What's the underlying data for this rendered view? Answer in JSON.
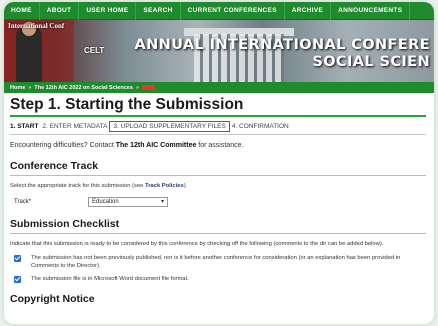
{
  "nav": {
    "items": [
      "HOME",
      "ABOUT",
      "USER HOME",
      "SEARCH",
      "CURRENT CONFERENCES",
      "ARCHIVE",
      "ANNOUNCEMENTS"
    ]
  },
  "banner": {
    "small_text": "International Conf",
    "mid_text": "CELT",
    "title": "ANNUAL INTERNATIONAL CONFERE",
    "subtitle": "SOCIAL SCIEN"
  },
  "breadcrumb": {
    "home": "Home",
    "sep": "»",
    "conference": "The 12th AIC 2022 on Social Sciences",
    "current": "User"
  },
  "page": {
    "title": "Step 1. Starting the Submission"
  },
  "steps": [
    {
      "label": "1. START",
      "active": true,
      "highlighted": false
    },
    {
      "label": "2. ENTER METADATA",
      "active": false,
      "highlighted": false
    },
    {
      "label": "3. UPLOAD SUPPLEMENTARY FILES",
      "active": false,
      "highlighted": true
    },
    {
      "label": "4. CONFIRMATION",
      "active": false,
      "highlighted": false
    }
  ],
  "help": {
    "prefix": "Encountering difficulties? Contact ",
    "link": "The 12th AIC Committee",
    "suffix": " for assistance."
  },
  "track": {
    "heading": "Conference Track",
    "desc_prefix": "Select the appropriate track for this submission (see ",
    "desc_link": "Track Policies",
    "desc_suffix": ").",
    "label": "Track*",
    "selected": "Education"
  },
  "checklist": {
    "heading": "Submission Checklist",
    "desc": "Indicate that this submission is ready to be considered by this conference by checking off the following (comments to the dir can be added below).",
    "items": [
      "The submission has not been previously published, nor is it before another conference for consideration (or an explanation has been provided in Comments to the Director).",
      "The submission file is in Microsoft Word document file format."
    ]
  },
  "copyright": {
    "heading": "Copyright Notice"
  },
  "colors": {
    "nav_green": "#1f8a2e",
    "highlight_red": "#d62b2b",
    "checkbox_blue": "#2a6fd6"
  }
}
